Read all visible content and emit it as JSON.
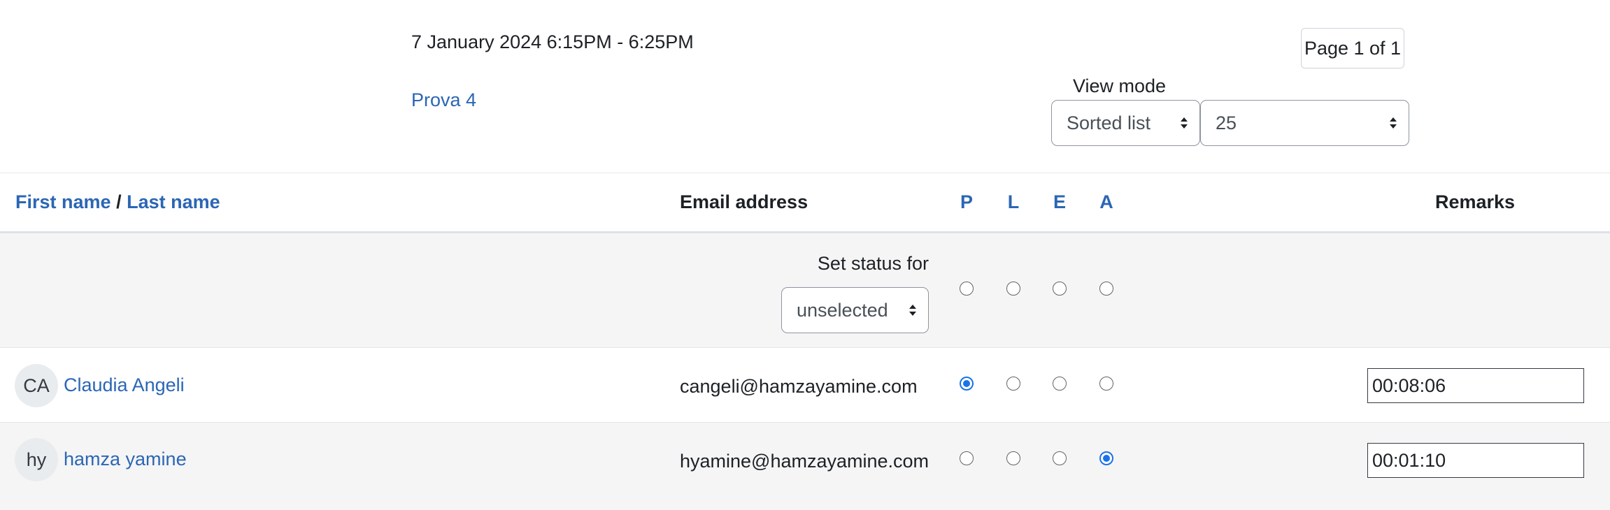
{
  "session": {
    "date": "7 January 2024 6:15PM - 6:25PM",
    "link": "Prova 4"
  },
  "pagination": {
    "label": "Page 1 of 1"
  },
  "view_mode": {
    "label": "View mode",
    "mode_selected": "Sorted list",
    "per_page_selected": "25"
  },
  "table": {
    "headers": {
      "first_name": "First name",
      "separator": "/",
      "last_name": "Last name",
      "email": "Email address",
      "status": [
        "P",
        "L",
        "E",
        "A"
      ],
      "remarks": "Remarks"
    },
    "set_status": {
      "label": "Set status for",
      "selected": "unselected"
    },
    "rows": [
      {
        "initials": "CA",
        "name": "Claudia Angeli",
        "email": "cangeli@hamzayamine.com",
        "status": "P",
        "remark": "00:08:06"
      },
      {
        "initials": "hy",
        "name": "hamza yamine",
        "email": "hyamine@hamzayamine.com",
        "status": "A",
        "remark": "00:01:10"
      }
    ]
  },
  "colors": {
    "link": "#2b66b5",
    "radio_checked": "#1a73e8",
    "row_alt": "#f5f5f5"
  },
  "icons": [
    "select-caret-icon",
    "avatar"
  ]
}
